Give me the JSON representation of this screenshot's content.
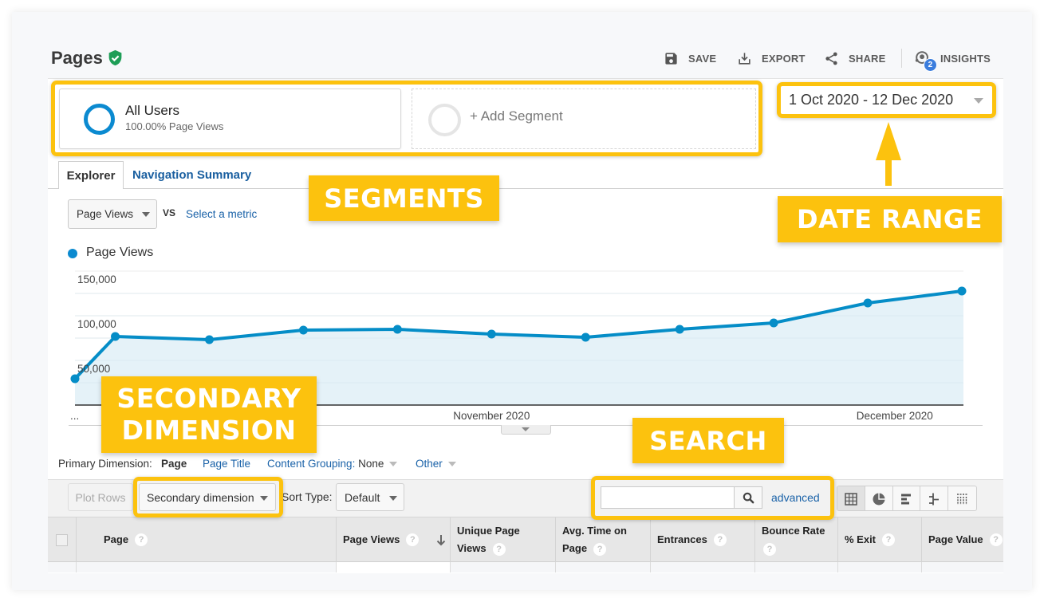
{
  "page": {
    "title": "Pages",
    "verified_icon": "shield-check-icon"
  },
  "toolbar": {
    "actions": [
      {
        "label": "SAVE",
        "icon": "save-icon"
      },
      {
        "label": "EXPORT",
        "icon": "download-icon"
      },
      {
        "label": "SHARE",
        "icon": "share-icon"
      },
      {
        "label": "INSIGHTS",
        "icon": "insights-icon",
        "badge": "2"
      }
    ]
  },
  "segments": {
    "items": [
      {
        "name": "All Users",
        "detail": "100.00% Page Views"
      }
    ],
    "add_label": "+ Add Segment"
  },
  "date_range": {
    "value": "1 Oct 2020 - 12 Dec 2020"
  },
  "tabs": [
    {
      "label": "Explorer",
      "active": true
    },
    {
      "label": "Navigation Summary",
      "active": false
    }
  ],
  "metric": {
    "selected": "Page Views",
    "vs": "VS",
    "compare_link": "Select a metric"
  },
  "legend": {
    "label": "Page Views"
  },
  "chart_data": {
    "type": "area",
    "title": "",
    "xlabel": "",
    "ylabel": "",
    "x": [
      "2020-10-01",
      "2020-10-04",
      "2020-10-11",
      "2020-10-18",
      "2020-10-25",
      "2020-11-01",
      "2020-11-08",
      "2020-11-15",
      "2020-11-22",
      "2020-11-29",
      "2020-12-06"
    ],
    "x_range": [
      "2020-10-01",
      "2020-12-06"
    ],
    "series": [
      {
        "name": "Page Views",
        "color": "#058dc7",
        "fill": "#e4f1f8",
        "values": [
          29500,
          76800,
          73200,
          83900,
          84800,
          79500,
          75900,
          84800,
          92000,
          114300,
          127700
        ]
      }
    ],
    "ylim": [
      0,
      150000
    ],
    "grid": true,
    "grid_step": 25000,
    "y_ticks": [
      {
        "label": "150,000",
        "value": 150000
      },
      {
        "label": "100,000",
        "value": 100000
      },
      {
        "label": "50,000",
        "value": 50000
      }
    ],
    "x_ticks": [
      {
        "label": "...",
        "at": "2020-10-01",
        "align": "start"
      },
      {
        "label": "November 2020",
        "at": "2020-11-01",
        "align": "middle"
      },
      {
        "label": "December 2020",
        "at": "2020-12-01",
        "align": "middle"
      }
    ],
    "legend": "top-left"
  },
  "dimension": {
    "label": "Primary Dimension:",
    "active": "Page",
    "page_title": "Page Title",
    "content_grouping_label": "Content Grouping:",
    "content_grouping_value": "None",
    "other": "Other"
  },
  "table_controls": {
    "plot_rows": "Plot Rows",
    "secondary_dimension": "Secondary dimension",
    "sort_type_label": "Sort Type:",
    "sort_type_value": "Default",
    "search_value": "",
    "advanced": "advanced",
    "view_modes": [
      {
        "name": "table",
        "active": true
      },
      {
        "name": "percentage"
      },
      {
        "name": "performance"
      },
      {
        "name": "comparison"
      },
      {
        "name": "pivot"
      }
    ]
  },
  "table": {
    "columns": [
      {
        "label": "Page",
        "help": "?"
      },
      {
        "label": "Page Views",
        "help": "?",
        "sort": "descending"
      },
      {
        "label": "Unique Page Views",
        "help": "?"
      },
      {
        "label": "Avg. Time on Page",
        "help": "?"
      },
      {
        "label": "Entrances",
        "help": "?"
      },
      {
        "label": "Bounce Rate",
        "help": "?"
      },
      {
        "label": "% Exit",
        "help": "?"
      },
      {
        "label": "Page Value",
        "help": "?"
      }
    ]
  },
  "annotations": {
    "accent": "#fcc20e",
    "segments": "SEGMENTS",
    "date_range": "DATE RANGE",
    "secondary_dimension_lines": [
      "SECONDARY",
      "DIMENSION"
    ],
    "search": "SEARCH"
  }
}
